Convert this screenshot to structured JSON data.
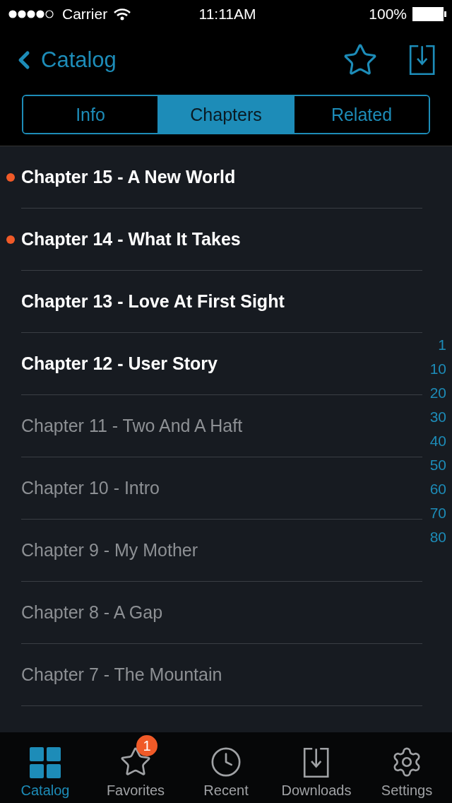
{
  "status_bar": {
    "carrier": "Carrier",
    "time": "11:11AM",
    "battery": "100%"
  },
  "nav": {
    "back": "Catalog"
  },
  "tabs": [
    {
      "label": "Info",
      "selected": false
    },
    {
      "label": "Chapters",
      "selected": true
    },
    {
      "label": "Related",
      "selected": false
    }
  ],
  "chapters": [
    {
      "title": "Chapter 15 - A New World",
      "new": true,
      "read": false
    },
    {
      "title": "Chapter 14 - What It Takes",
      "new": true,
      "read": false
    },
    {
      "title": "Chapter 13 - Love At First Sight",
      "new": false,
      "read": false
    },
    {
      "title": "Chapter 12 - User Story",
      "new": false,
      "read": false
    },
    {
      "title": "Chapter 11 - Two And A Haft",
      "new": false,
      "read": true
    },
    {
      "title": "Chapter 10 - Intro",
      "new": false,
      "read": true
    },
    {
      "title": "Chapter 9 - My Mother",
      "new": false,
      "read": true
    },
    {
      "title": "Chapter 8 - A Gap",
      "new": false,
      "read": true
    },
    {
      "title": "Chapter 7 - The Mountain",
      "new": false,
      "read": true
    }
  ],
  "index": [
    "1",
    "10",
    "20",
    "30",
    "40",
    "50",
    "60",
    "70",
    "80"
  ],
  "tab_bar": [
    {
      "kind": "grid",
      "label": "Catalog",
      "selected": true
    },
    {
      "kind": "star",
      "label": "Favorites",
      "selected": false,
      "badge": "1"
    },
    {
      "kind": "clock",
      "label": "Recent",
      "selected": false
    },
    {
      "kind": "download",
      "label": "Downloads",
      "selected": false
    },
    {
      "kind": "gear",
      "label": "Settings",
      "selected": false
    }
  ]
}
